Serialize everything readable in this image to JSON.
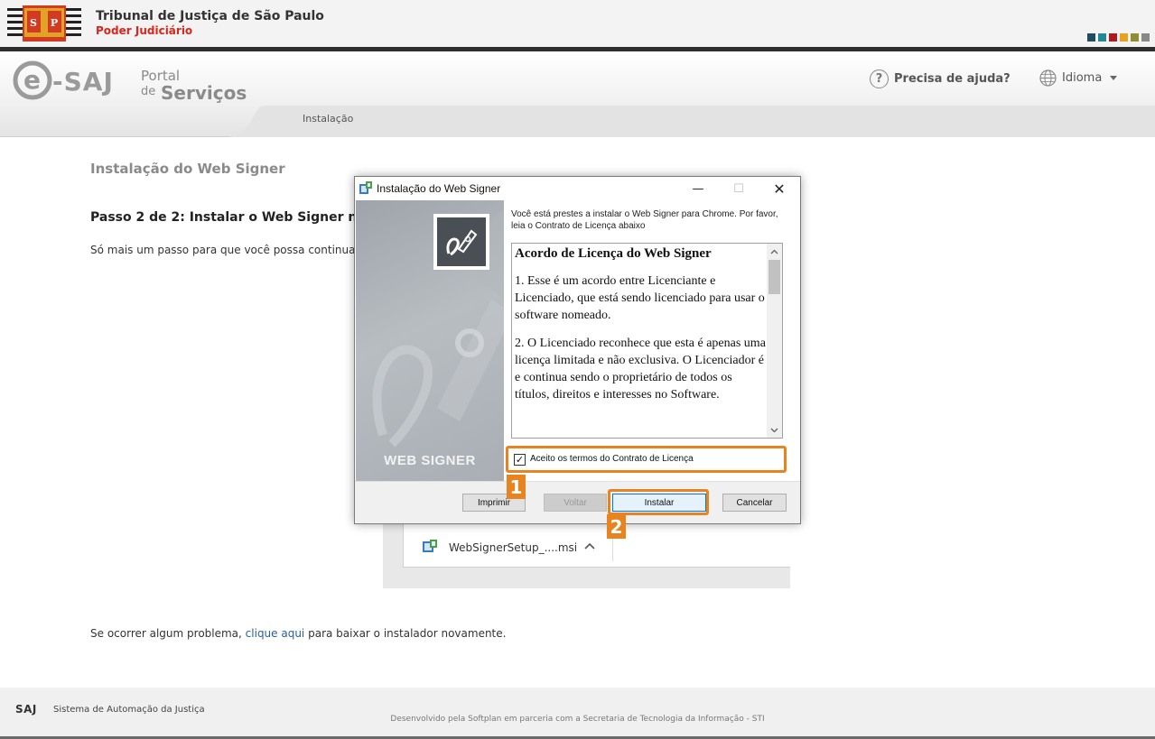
{
  "header": {
    "title": "Tribunal de Justiça de São Paulo",
    "subtitle": "Poder Judiciário",
    "flag_text": "S P",
    "color_squares": [
      "#1f4e60",
      "#1f8a96",
      "#b01a1a",
      "#e7a020",
      "#8e8e33",
      "#888888"
    ]
  },
  "esaj": {
    "logo_main": "e-SAJ",
    "logo_portal": "Portal",
    "logo_de": "de",
    "logo_servicos": "Serviços",
    "help_label": "Precisa de ajuda?",
    "help_icon": "?",
    "language_label": "Idioma",
    "breadcrumb": "Instalação"
  },
  "page": {
    "title": "Instalação do Web Signer",
    "step_title": "Passo 2 de 2: Instalar o Web Signer n",
    "step_text": "Só mais um passo para que você possa continua",
    "problem_prefix": "Se ocorrer algum problema, ",
    "problem_link": "clique aqui",
    "problem_suffix": " para baixar o instalador novamente."
  },
  "download": {
    "file_name": "WebSignerSetup_....msi",
    "chevron": "^"
  },
  "dialog": {
    "title": "Instalação do Web Signer",
    "minimize": "—",
    "maximize": "☐",
    "close": "✕",
    "side_label": "WEB SIGNER",
    "intro": "Você está prestes a instalar o Web Signer para Chrome. Por favor, leia o Contrato de Licença abaixo",
    "license_title": "Acordo de Licença do Web Signer",
    "license_p1": "1. Esse é um acordo entre Licenciante e Licenciado, que está sendo licenciado para usar o software nomeado.",
    "license_p2": "2. O Licenciado reconhece que esta é apenas uma licença limitada e não exclusiva. O Licenciador é e continua sendo o proprietário de todos os títulos, direitos e interesses no Software.",
    "accept_label": "Aceito os termos do Contrato de Licença",
    "accept_checked": true,
    "buttons": {
      "print": "Imprimir",
      "back": "Voltar",
      "install": "Instalar",
      "cancel": "Cancelar"
    },
    "step_markers": [
      "1",
      "2"
    ]
  },
  "footer": {
    "logo": "SAJ",
    "system": "Sistema de Automação da Justiça",
    "developed_by": "Desenvolvido pela Softplan em parceria com a Secretaria de Tecnologia da Informação - STI"
  },
  "colors": {
    "accent_orange": "#e8831f",
    "header_red": "#d8261c",
    "link_blue": "#2b5e9e"
  }
}
